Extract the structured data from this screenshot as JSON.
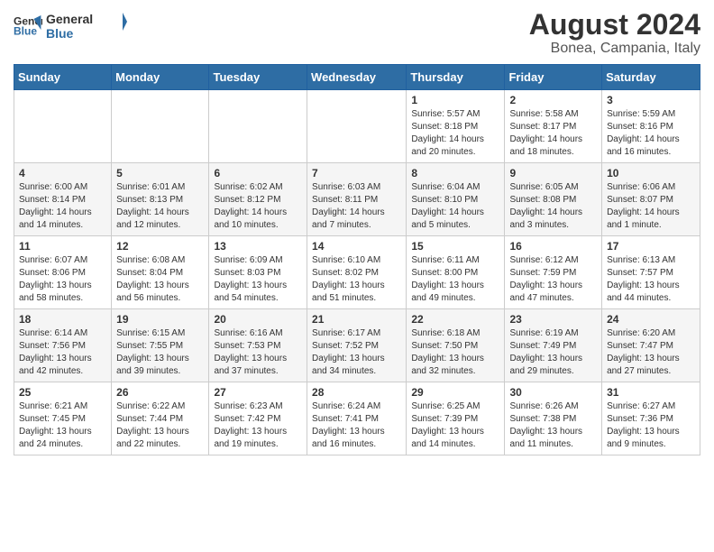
{
  "header": {
    "logo_line1": "General",
    "logo_line2": "Blue",
    "title": "August 2024",
    "subtitle": "Bonea, Campania, Italy"
  },
  "weekdays": [
    "Sunday",
    "Monday",
    "Tuesday",
    "Wednesday",
    "Thursday",
    "Friday",
    "Saturday"
  ],
  "weeks": [
    [
      {
        "day": "",
        "info": ""
      },
      {
        "day": "",
        "info": ""
      },
      {
        "day": "",
        "info": ""
      },
      {
        "day": "",
        "info": ""
      },
      {
        "day": "1",
        "info": "Sunrise: 5:57 AM\nSunset: 8:18 PM\nDaylight: 14 hours\nand 20 minutes."
      },
      {
        "day": "2",
        "info": "Sunrise: 5:58 AM\nSunset: 8:17 PM\nDaylight: 14 hours\nand 18 minutes."
      },
      {
        "day": "3",
        "info": "Sunrise: 5:59 AM\nSunset: 8:16 PM\nDaylight: 14 hours\nand 16 minutes."
      }
    ],
    [
      {
        "day": "4",
        "info": "Sunrise: 6:00 AM\nSunset: 8:14 PM\nDaylight: 14 hours\nand 14 minutes."
      },
      {
        "day": "5",
        "info": "Sunrise: 6:01 AM\nSunset: 8:13 PM\nDaylight: 14 hours\nand 12 minutes."
      },
      {
        "day": "6",
        "info": "Sunrise: 6:02 AM\nSunset: 8:12 PM\nDaylight: 14 hours\nand 10 minutes."
      },
      {
        "day": "7",
        "info": "Sunrise: 6:03 AM\nSunset: 8:11 PM\nDaylight: 14 hours\nand 7 minutes."
      },
      {
        "day": "8",
        "info": "Sunrise: 6:04 AM\nSunset: 8:10 PM\nDaylight: 14 hours\nand 5 minutes."
      },
      {
        "day": "9",
        "info": "Sunrise: 6:05 AM\nSunset: 8:08 PM\nDaylight: 14 hours\nand 3 minutes."
      },
      {
        "day": "10",
        "info": "Sunrise: 6:06 AM\nSunset: 8:07 PM\nDaylight: 14 hours\nand 1 minute."
      }
    ],
    [
      {
        "day": "11",
        "info": "Sunrise: 6:07 AM\nSunset: 8:06 PM\nDaylight: 13 hours\nand 58 minutes."
      },
      {
        "day": "12",
        "info": "Sunrise: 6:08 AM\nSunset: 8:04 PM\nDaylight: 13 hours\nand 56 minutes."
      },
      {
        "day": "13",
        "info": "Sunrise: 6:09 AM\nSunset: 8:03 PM\nDaylight: 13 hours\nand 54 minutes."
      },
      {
        "day": "14",
        "info": "Sunrise: 6:10 AM\nSunset: 8:02 PM\nDaylight: 13 hours\nand 51 minutes."
      },
      {
        "day": "15",
        "info": "Sunrise: 6:11 AM\nSunset: 8:00 PM\nDaylight: 13 hours\nand 49 minutes."
      },
      {
        "day": "16",
        "info": "Sunrise: 6:12 AM\nSunset: 7:59 PM\nDaylight: 13 hours\nand 47 minutes."
      },
      {
        "day": "17",
        "info": "Sunrise: 6:13 AM\nSunset: 7:57 PM\nDaylight: 13 hours\nand 44 minutes."
      }
    ],
    [
      {
        "day": "18",
        "info": "Sunrise: 6:14 AM\nSunset: 7:56 PM\nDaylight: 13 hours\nand 42 minutes."
      },
      {
        "day": "19",
        "info": "Sunrise: 6:15 AM\nSunset: 7:55 PM\nDaylight: 13 hours\nand 39 minutes."
      },
      {
        "day": "20",
        "info": "Sunrise: 6:16 AM\nSunset: 7:53 PM\nDaylight: 13 hours\nand 37 minutes."
      },
      {
        "day": "21",
        "info": "Sunrise: 6:17 AM\nSunset: 7:52 PM\nDaylight: 13 hours\nand 34 minutes."
      },
      {
        "day": "22",
        "info": "Sunrise: 6:18 AM\nSunset: 7:50 PM\nDaylight: 13 hours\nand 32 minutes."
      },
      {
        "day": "23",
        "info": "Sunrise: 6:19 AM\nSunset: 7:49 PM\nDaylight: 13 hours\nand 29 minutes."
      },
      {
        "day": "24",
        "info": "Sunrise: 6:20 AM\nSunset: 7:47 PM\nDaylight: 13 hours\nand 27 minutes."
      }
    ],
    [
      {
        "day": "25",
        "info": "Sunrise: 6:21 AM\nSunset: 7:45 PM\nDaylight: 13 hours\nand 24 minutes."
      },
      {
        "day": "26",
        "info": "Sunrise: 6:22 AM\nSunset: 7:44 PM\nDaylight: 13 hours\nand 22 minutes."
      },
      {
        "day": "27",
        "info": "Sunrise: 6:23 AM\nSunset: 7:42 PM\nDaylight: 13 hours\nand 19 minutes."
      },
      {
        "day": "28",
        "info": "Sunrise: 6:24 AM\nSunset: 7:41 PM\nDaylight: 13 hours\nand 16 minutes."
      },
      {
        "day": "29",
        "info": "Sunrise: 6:25 AM\nSunset: 7:39 PM\nDaylight: 13 hours\nand 14 minutes."
      },
      {
        "day": "30",
        "info": "Sunrise: 6:26 AM\nSunset: 7:38 PM\nDaylight: 13 hours\nand 11 minutes."
      },
      {
        "day": "31",
        "info": "Sunrise: 6:27 AM\nSunset: 7:36 PM\nDaylight: 13 hours\nand 9 minutes."
      }
    ]
  ]
}
